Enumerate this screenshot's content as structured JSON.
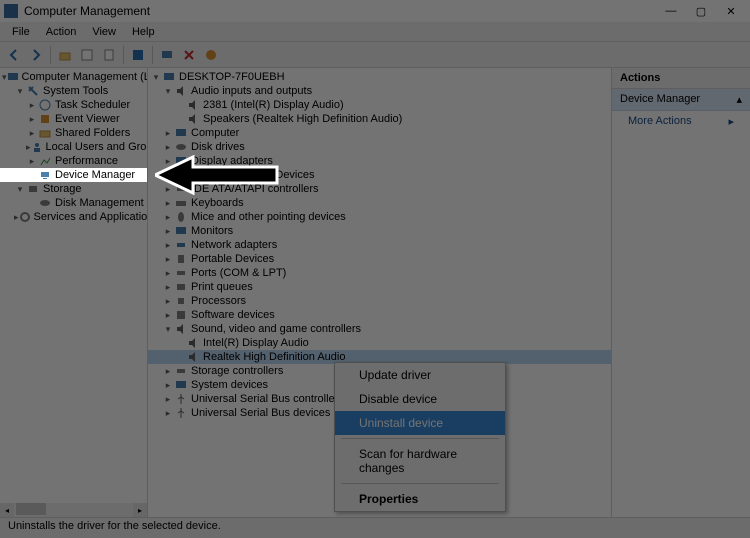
{
  "window": {
    "title": "Computer Management",
    "min": "—",
    "max": "▢",
    "close": "✕"
  },
  "menu": [
    "File",
    "Action",
    "View",
    "Help"
  ],
  "toolbar": {
    "back": "◄",
    "fwd": "►"
  },
  "left_tree": {
    "root": "Computer Management (Local",
    "system_tools": "System Tools",
    "st_items": [
      "Task Scheduler",
      "Event Viewer",
      "Shared Folders",
      "Local Users and Groups",
      "Performance",
      "Device Manager"
    ],
    "storage": "Storage",
    "storage_items": [
      "Disk Management"
    ],
    "services": "Services and Applications"
  },
  "mid_tree": {
    "root": "DESKTOP-7F0UEBH",
    "audio": "Audio inputs and outputs",
    "audio_items": [
      "2381 (Intel(R) Display Audio)",
      "Speakers (Realtek High Definition Audio)"
    ],
    "cats": [
      "Computer",
      "Disk drives",
      "Display adapters",
      "Human Interface Devices",
      "IDE ATA/ATAPI controllers",
      "Keyboards",
      "Mice and other pointing devices",
      "Monitors",
      "Network adapters",
      "Portable Devices",
      "Ports (COM & LPT)",
      "Print queues",
      "Processors",
      "Software devices"
    ],
    "svgc": "Sound, video and game controllers",
    "svgc_items": [
      "Intel(R) Display Audio",
      "Realtek High Definition Audio"
    ],
    "tail": [
      "Storage controllers",
      "System devices",
      "Universal Serial Bus controllers",
      "Universal Serial Bus devices"
    ]
  },
  "context": {
    "items": [
      "Update driver",
      "Disable device",
      "Uninstall device",
      "Scan for hardware changes",
      "Properties"
    ],
    "selected_index": 2
  },
  "actions": {
    "header": "Actions",
    "selected": "Device Manager",
    "more": "More Actions"
  },
  "status": "Uninstalls the driver for the selected device."
}
